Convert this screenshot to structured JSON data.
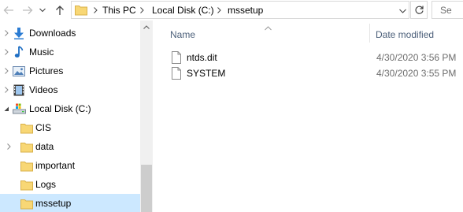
{
  "toolbar": {
    "back_icon": "back-arrow-icon",
    "forward_icon": "forward-arrow-icon",
    "history_icon": "chevron-down-icon",
    "up_icon": "up-arrow-icon"
  },
  "address_bar": {
    "icon": "folder-icon",
    "breadcrumbs": [
      "This PC",
      "Local Disk (C:)",
      "mssetup"
    ],
    "refresh_icon": "refresh-icon"
  },
  "search": {
    "placeholder": "Se"
  },
  "sidebar": {
    "items": [
      {
        "label": "Downloads",
        "icon": "download-icon",
        "expandable": true
      },
      {
        "label": "Music",
        "icon": "music-icon",
        "expandable": true
      },
      {
        "label": "Pictures",
        "icon": "pictures-icon",
        "expandable": true
      },
      {
        "label": "Videos",
        "icon": "videos-icon",
        "expandable": true
      },
      {
        "label": "Local Disk (C:)",
        "icon": "drive-icon",
        "expanded": true
      },
      {
        "label": "CIS",
        "icon": "folder-icon",
        "expandable": false
      },
      {
        "label": "data",
        "icon": "folder-icon",
        "expandable": true
      },
      {
        "label": "important",
        "icon": "folder-icon",
        "expandable": false
      },
      {
        "label": "Logs",
        "icon": "folder-icon",
        "expandable": false
      },
      {
        "label": "mssetup",
        "icon": "folder-icon",
        "expandable": false,
        "selected": true
      }
    ]
  },
  "file_list": {
    "columns": {
      "name": "Name",
      "date_modified": "Date modified"
    },
    "sort_indicator": "sort-ascending-icon",
    "rows": [
      {
        "name": "ntds.dit",
        "date_modified": "4/30/2020 3:56 PM",
        "icon": "file-icon"
      },
      {
        "name": "SYSTEM",
        "date_modified": "4/30/2020 3:55 PM",
        "icon": "file-icon"
      }
    ]
  },
  "colors": {
    "selection": "#cce8ff",
    "folder": "#f8d775",
    "header_text": "#4c607a",
    "date_text": "#6d6d6d",
    "border": "#d9d9d9"
  }
}
